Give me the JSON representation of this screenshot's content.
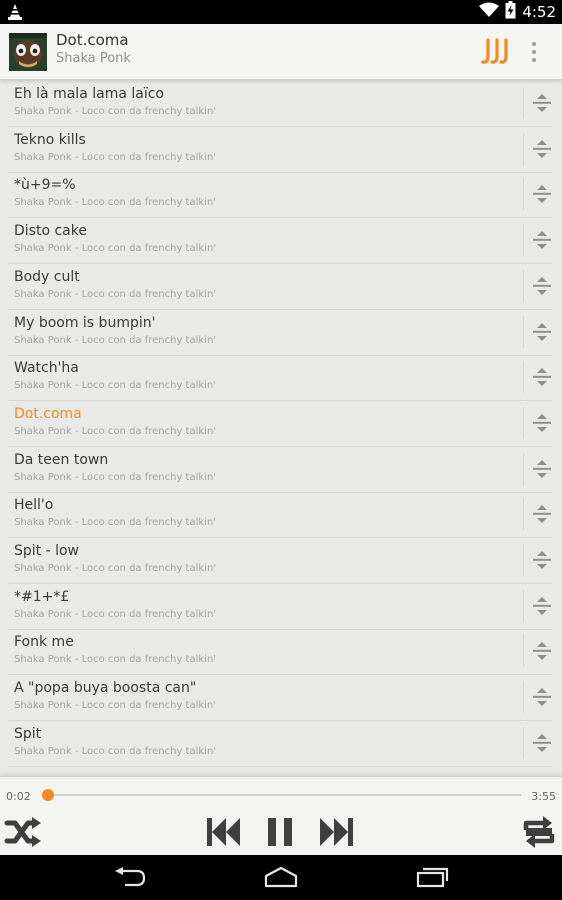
{
  "status": {
    "time": "4:52"
  },
  "now_playing": {
    "title": "Dot.coma",
    "artist": "Shaka Ponk"
  },
  "tracks": [
    {
      "title": "Eh là mala lama laïco",
      "subtitle": "Shaka Ponk - Loco con da frenchy talkin'"
    },
    {
      "title": "Tekno kills",
      "subtitle": "Shaka Ponk - Loco con da frenchy talkin'"
    },
    {
      "title": "*ù+9=%",
      "subtitle": "Shaka Ponk - Loco con da frenchy talkin'"
    },
    {
      "title": "Disto cake",
      "subtitle": "Shaka Ponk - Loco con da frenchy talkin'"
    },
    {
      "title": "Body cult",
      "subtitle": "Shaka Ponk - Loco con da frenchy talkin'"
    },
    {
      "title": "My boom is bumpin'",
      "subtitle": "Shaka Ponk - Loco con da frenchy talkin'"
    },
    {
      "title": "Watch'ha",
      "subtitle": "Shaka Ponk - Loco con da frenchy talkin'"
    },
    {
      "title": "Dot.coma",
      "subtitle": "Shaka Ponk - Loco con da frenchy talkin'",
      "active": true
    },
    {
      "title": "Da teen town",
      "subtitle": "Shaka Ponk - Loco con da frenchy talkin'"
    },
    {
      "title": "Hell'o",
      "subtitle": "Shaka Ponk - Loco con da frenchy talkin'"
    },
    {
      "title": "Spit - low",
      "subtitle": "Shaka Ponk - Loco con da frenchy talkin'"
    },
    {
      "title": "*#1+*£",
      "subtitle": "Shaka Ponk - Loco con da frenchy talkin'"
    },
    {
      "title": "Fonk me",
      "subtitle": "Shaka Ponk - Loco con da frenchy talkin'"
    },
    {
      "title": "A \"popa buya boosta can\"",
      "subtitle": "Shaka Ponk - Loco con da frenchy talkin'"
    },
    {
      "title": "Spit",
      "subtitle": "Shaka Ponk - Loco con da frenchy talkin'"
    }
  ],
  "player": {
    "elapsed": "0:02",
    "total": "3:55",
    "progress": 0.0085
  },
  "colors": {
    "accent": "#f28a1e",
    "controls": "#3f3f3f"
  },
  "icons": {
    "status": [
      "vlc-cone-icon",
      "wifi-icon",
      "battery-charging-icon"
    ],
    "header": [
      "playlist-icon",
      "overflow-menu-icon"
    ],
    "track": "drag-handle-icon",
    "player": [
      "shuffle-icon",
      "previous-icon",
      "pause-icon",
      "next-icon",
      "repeat-icon"
    ],
    "nav": [
      "back-icon",
      "home-icon",
      "recent-apps-icon"
    ]
  }
}
